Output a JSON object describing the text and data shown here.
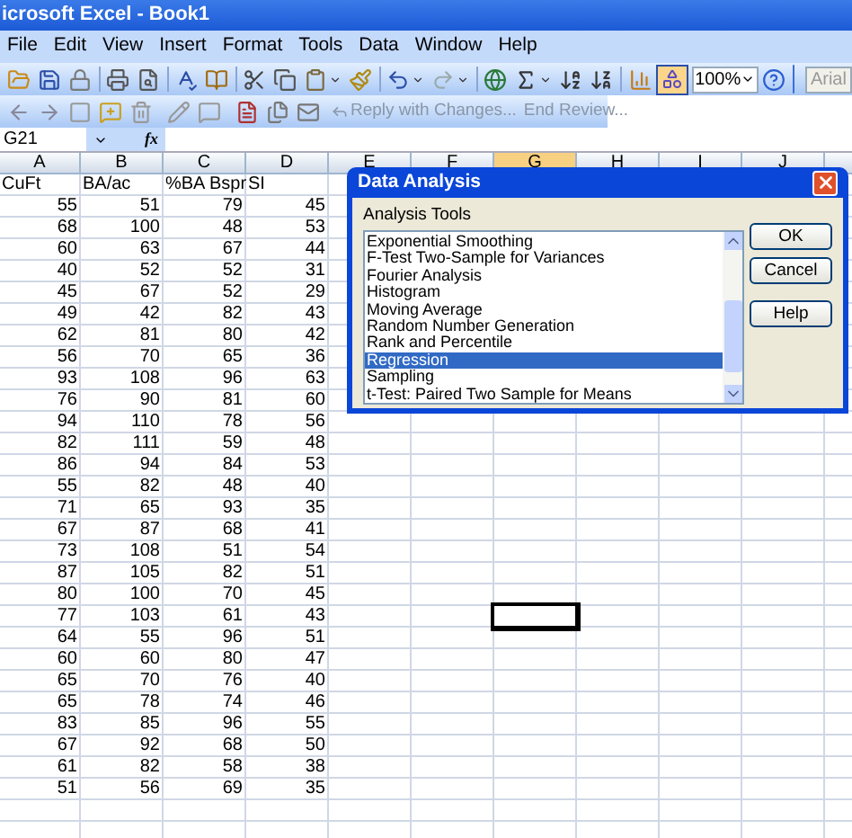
{
  "window": {
    "title": "icrosoft Excel - Book1"
  },
  "menu": [
    "File",
    "Edit",
    "View",
    "Insert",
    "Format",
    "Tools",
    "Data",
    "Window",
    "Help"
  ],
  "toolbar": {
    "zoom": "100%",
    "font": "Arial"
  },
  "reviewing_toolbar": {
    "reply": "Reply with Changes...",
    "end_review": "End Review..."
  },
  "formula_bar": {
    "name_box": "G21",
    "function_label": "fx"
  },
  "sheet": {
    "columns": [
      {
        "label": "A",
        "selected": false
      },
      {
        "label": "B",
        "selected": false
      },
      {
        "label": "C",
        "selected": false
      },
      {
        "label": "D",
        "selected": false
      },
      {
        "label": "E",
        "selected": false
      },
      {
        "label": "F",
        "selected": false
      },
      {
        "label": "G",
        "selected": true
      },
      {
        "label": "H",
        "selected": false
      },
      {
        "label": "I",
        "selected": false
      },
      {
        "label": "J",
        "selected": false
      }
    ],
    "header_row": [
      "CuFt",
      "BA/ac",
      "%BA Bspr",
      "SI"
    ],
    "rows": [
      {
        "cells": [
          "55",
          "51",
          "79",
          "45"
        ],
        "selected": false
      },
      {
        "cells": [
          "68",
          "100",
          "48",
          "53"
        ],
        "selected": false
      },
      {
        "cells": [
          "60",
          "63",
          "67",
          "44"
        ],
        "selected": false
      },
      {
        "cells": [
          "40",
          "52",
          "52",
          "31"
        ],
        "selected": false
      },
      {
        "cells": [
          "45",
          "67",
          "52",
          "29"
        ],
        "selected": false
      },
      {
        "cells": [
          "49",
          "42",
          "82",
          "43"
        ],
        "selected": false
      },
      {
        "cells": [
          "62",
          "81",
          "80",
          "42"
        ],
        "selected": false
      },
      {
        "cells": [
          "56",
          "70",
          "65",
          "36"
        ],
        "selected": false
      },
      {
        "cells": [
          "93",
          "108",
          "96",
          "63"
        ],
        "selected": false
      },
      {
        "cells": [
          "76",
          "90",
          "81",
          "60"
        ],
        "selected": false
      },
      {
        "cells": [
          "94",
          "110",
          "78",
          "56"
        ],
        "selected": false
      },
      {
        "cells": [
          "82",
          "111",
          "59",
          "48"
        ],
        "selected": false
      },
      {
        "cells": [
          "86",
          "94",
          "84",
          "53"
        ],
        "selected": false
      },
      {
        "cells": [
          "55",
          "82",
          "48",
          "40"
        ],
        "selected": false
      },
      {
        "cells": [
          "71",
          "65",
          "93",
          "35"
        ],
        "selected": false
      },
      {
        "cells": [
          "67",
          "87",
          "68",
          "41"
        ],
        "selected": false
      },
      {
        "cells": [
          "73",
          "108",
          "51",
          "54"
        ],
        "selected": false
      },
      {
        "cells": [
          "87",
          "105",
          "82",
          "51"
        ],
        "selected": false
      },
      {
        "cells": [
          "80",
          "100",
          "70",
          "45"
        ],
        "selected": false
      },
      {
        "cells": [
          "77",
          "103",
          "61",
          "43"
        ],
        "selected": true
      },
      {
        "cells": [
          "64",
          "55",
          "96",
          "51"
        ],
        "selected": false
      },
      {
        "cells": [
          "60",
          "60",
          "80",
          "47"
        ],
        "selected": false
      },
      {
        "cells": [
          "65",
          "70",
          "76",
          "40"
        ],
        "selected": false
      },
      {
        "cells": [
          "65",
          "78",
          "74",
          "46"
        ],
        "selected": false
      },
      {
        "cells": [
          "83",
          "85",
          "96",
          "55"
        ],
        "selected": false
      },
      {
        "cells": [
          "67",
          "92",
          "68",
          "50"
        ],
        "selected": false
      },
      {
        "cells": [
          "61",
          "82",
          "58",
          "38"
        ],
        "selected": false
      },
      {
        "cells": [
          "51",
          "56",
          "69",
          "35"
        ],
        "selected": false
      }
    ]
  },
  "dialog": {
    "title": "Data Analysis",
    "list_label": "Analysis Tools",
    "items": [
      {
        "label": "Exponential Smoothing",
        "selected": false
      },
      {
        "label": "F-Test Two-Sample for Variances",
        "selected": false
      },
      {
        "label": "Fourier Analysis",
        "selected": false
      },
      {
        "label": "Histogram",
        "selected": false
      },
      {
        "label": "Moving Average",
        "selected": false
      },
      {
        "label": "Random Number Generation",
        "selected": false
      },
      {
        "label": "Rank and Percentile",
        "selected": false
      },
      {
        "label": "Regression",
        "selected": true
      },
      {
        "label": "Sampling",
        "selected": false
      },
      {
        "label": "t-Test: Paired Two Sample for Means",
        "selected": false
      }
    ],
    "buttons": [
      "OK",
      "Cancel",
      "Help"
    ]
  }
}
